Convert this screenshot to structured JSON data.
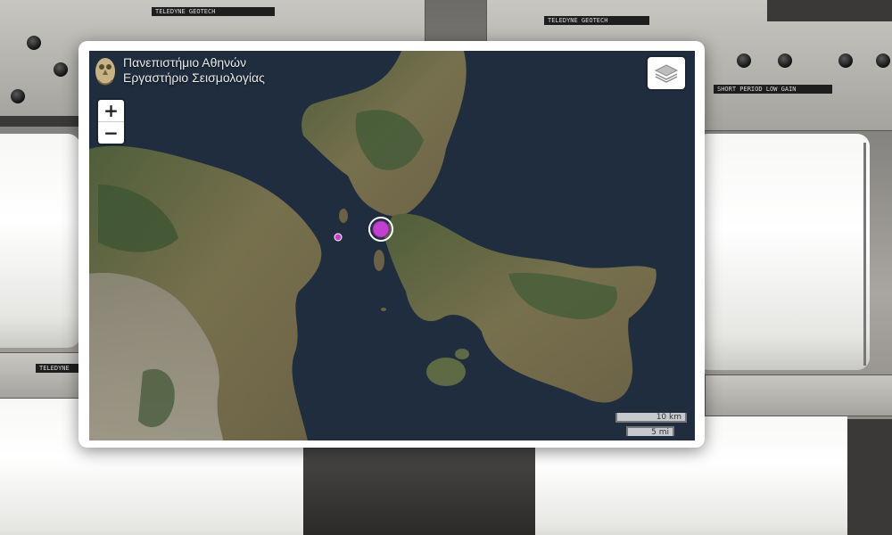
{
  "background": {
    "equipment_labels": [
      "TELEDYNE GEOTECH",
      "TELEDYNE GEOTECH",
      "SHORT PERIOD   LOW GAIN",
      "TELEDYNE"
    ]
  },
  "map": {
    "attribution": {
      "line1": "Πανεπιστήμιο Αθηνών",
      "line2": "Εργαστήριο Σεισμολογίας",
      "logo_icon": "owl-athena-icon"
    },
    "zoom": {
      "in_label": "+",
      "out_label": "−"
    },
    "layers_control": {
      "icon": "layers-icon"
    },
    "scale": {
      "metric": "10 km",
      "imperial": "5 mi"
    },
    "events": [
      {
        "name": "main-earthquake",
        "color": "#c23fd0"
      },
      {
        "name": "secondary-earthquake",
        "color": "#c23fd0"
      }
    ],
    "colors": {
      "sea": "#1f2d3e",
      "land": "#6e6a4a",
      "vegetation": "#3f5a36",
      "urban": "#9a948a"
    }
  }
}
